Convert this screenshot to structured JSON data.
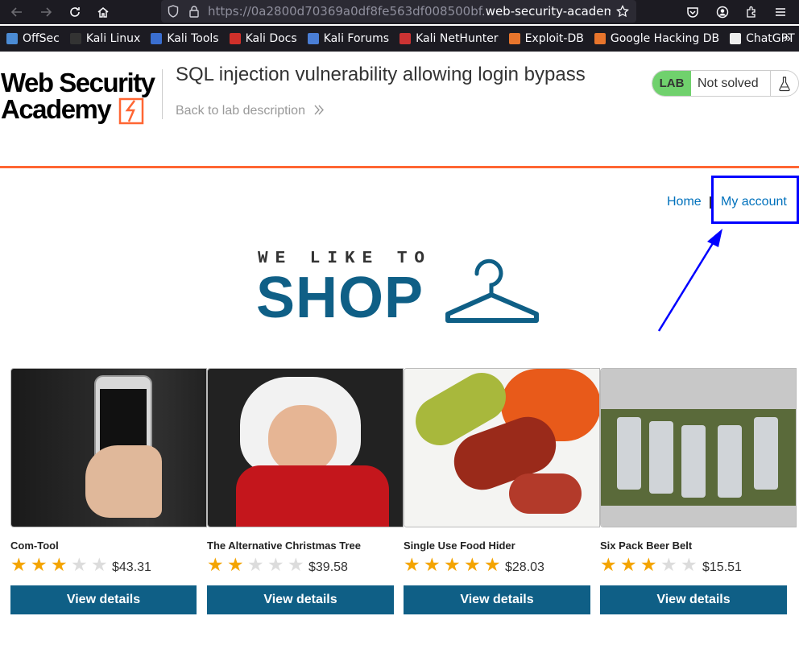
{
  "browser": {
    "url_prefix": "https://0a2800d70369a0df8fe563df008500bf.",
    "url_domain": "web-security-academy.ne",
    "bookmarks": [
      {
        "label": "OffSec",
        "color": "#4b8bd4"
      },
      {
        "label": "Kali Linux",
        "color": "#333333"
      },
      {
        "label": "Kali Tools",
        "color": "#3a6ed0"
      },
      {
        "label": "Kali Docs",
        "color": "#d0302a"
      },
      {
        "label": "Kali Forums",
        "color": "#4a7ed6"
      },
      {
        "label": "Kali NetHunter",
        "color": "#cc3333"
      },
      {
        "label": "Exploit-DB",
        "color": "#e8752c"
      },
      {
        "label": "Google Hacking DB",
        "color": "#e8752c"
      },
      {
        "label": "ChatGPT",
        "color": "#eeeeee"
      }
    ]
  },
  "header": {
    "logo_line1": "Web Security",
    "logo_line2": "Academy",
    "lab_title": "SQL injection vulnerability allowing login bypass",
    "back_link": "Back to lab description",
    "badge_lab": "LAB",
    "badge_status": "Not solved",
    "accent_color": "#ff6633"
  },
  "nav": {
    "home": "Home",
    "separator": "|",
    "my_account": "My account"
  },
  "banner": {
    "tagline": "WE LIKE TO",
    "word": "SHOP"
  },
  "products": [
    {
      "name": "Com-Tool",
      "rating": 3,
      "price": "$43.31",
      "button": "View details"
    },
    {
      "name": "The Alternative Christmas Tree",
      "rating": 2,
      "price": "$39.58",
      "button": "View details"
    },
    {
      "name": "Single Use Food Hider",
      "rating": 5,
      "price": "$28.03",
      "button": "View details"
    },
    {
      "name": "Six Pack Beer Belt",
      "rating": 3,
      "price": "$15.51",
      "button": "View details"
    }
  ]
}
